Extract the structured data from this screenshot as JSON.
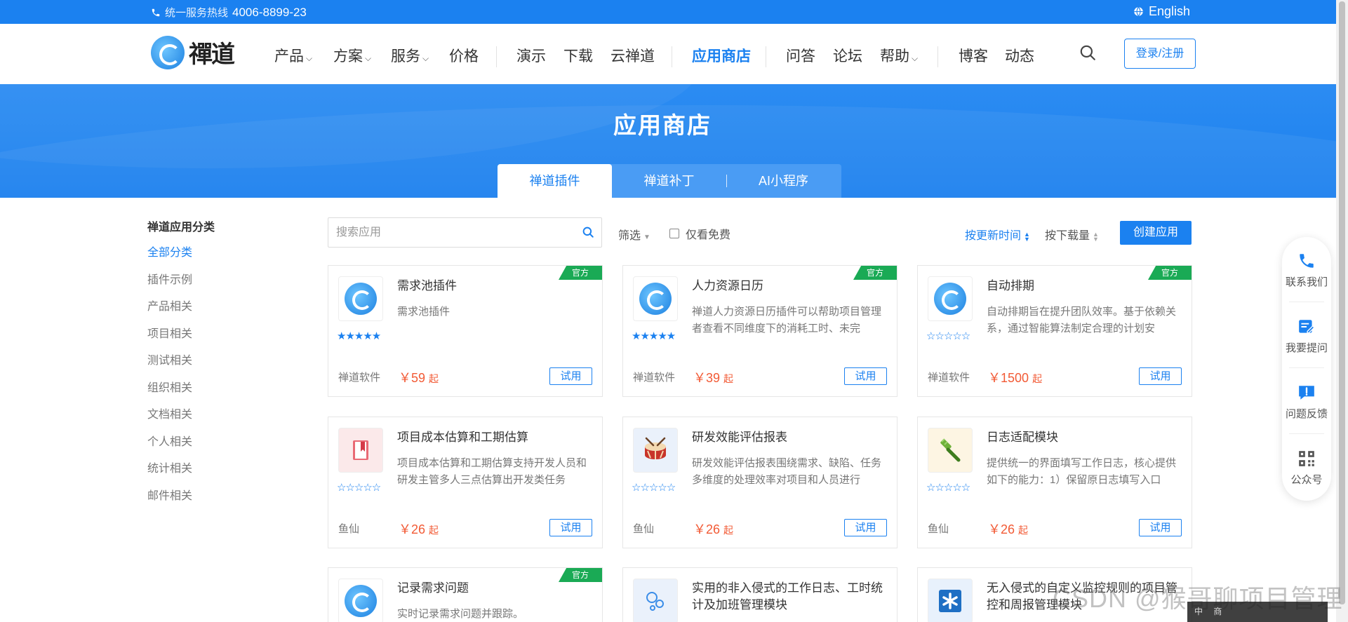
{
  "topbar": {
    "hotline_label": "统一服务热线",
    "hotline_number": "4006-8899-23",
    "language": "English"
  },
  "logo": {
    "text": "禪道"
  },
  "nav": {
    "items": [
      {
        "label": "产品",
        "has_menu": true
      },
      {
        "label": "方案",
        "has_menu": true
      },
      {
        "label": "服务",
        "has_menu": true
      },
      {
        "label": "价格"
      },
      {
        "label": "演示"
      },
      {
        "label": "下载"
      },
      {
        "label": "云禅道"
      },
      {
        "label": "应用商店",
        "active": true
      },
      {
        "label": "问答"
      },
      {
        "label": "论坛"
      },
      {
        "label": "帮助",
        "has_menu": true
      },
      {
        "label": "博客"
      },
      {
        "label": "动态"
      }
    ],
    "login_label": "登录/注册"
  },
  "banner": {
    "title": "应用商店",
    "tabs": [
      {
        "label": "禅道插件",
        "active": true
      },
      {
        "label": "禅道补丁"
      },
      {
        "label": "AI小程序"
      }
    ]
  },
  "sidebar": {
    "title": "禅道应用分类",
    "items": [
      "全部分类",
      "插件示例",
      "产品相关",
      "项目相关",
      "测试相关",
      "组织相关",
      "文档相关",
      "个人相关",
      "统计相关",
      "邮件相关"
    ],
    "active_index": 0
  },
  "toolbar": {
    "search_placeholder": "搜索应用",
    "filter_label": "筛选",
    "free_only_label": "仅看免费",
    "sort_update": "按更新时间",
    "sort_downloads": "按下载量",
    "create_label": "创建应用"
  },
  "cards": [
    {
      "name": "需求池插件",
      "desc": "需求池插件",
      "author": "禅道软件",
      "price": "￥59",
      "price_unit": "起",
      "try": "试用",
      "official": "官方",
      "rating": 5,
      "icon": "zentao-swirl-icon"
    },
    {
      "name": "人力资源日历",
      "desc": "禅道人力资源日历插件可以帮助项目管理者查看不同维度下的消耗工时、未完",
      "author": "禅道软件",
      "price": "￥39",
      "price_unit": "起",
      "try": "试用",
      "official": "官方",
      "rating": 5,
      "icon": "zentao-swirl-icon"
    },
    {
      "name": "自动排期",
      "desc": "自动排期旨在提升团队效率。基于依赖关系，通过智能算法制定合理的计划安",
      "author": "禅道软件",
      "price": "￥1500",
      "price_unit": "起",
      "try": "试用",
      "official": "官方",
      "rating": 0,
      "icon": "zentao-swirl-icon"
    },
    {
      "name": "项目成本估算和工期估算",
      "desc": "项目成本估算和工期估算支持开发人员和研发主管多人三点估算出开发类任务",
      "author": "鱼仙",
      "price": "￥26",
      "price_unit": "起",
      "try": "试用",
      "official": "",
      "rating": 0,
      "icon": "book-icon"
    },
    {
      "name": "研发效能评估报表",
      "desc": "研发效能评估报表围绕需求、缺陷、任务多维度的处理效率对项目和人员进行",
      "author": "鱼仙",
      "price": "￥26",
      "price_unit": "起",
      "try": "试用",
      "official": "",
      "rating": 0,
      "icon": "drum-icon"
    },
    {
      "name": "日志适配模块",
      "desc": "提供统一的界面填写工作日志，核心提供如下的能力：1）保留原日志填写入口",
      "author": "鱼仙",
      "price": "￥26",
      "price_unit": "起",
      "try": "试用",
      "official": "",
      "rating": 0,
      "icon": "razor-icon"
    },
    {
      "name": "记录需求问题",
      "desc": "实时记录需求问题并跟踪。",
      "official": "官方",
      "icon": "zentao-swirl-icon"
    },
    {
      "name": "实用的非入侵式的工作日志、工时统计及加班管理模块",
      "icon": "bubbles-icon"
    },
    {
      "name": "无入侵式的自定义监控规则的项目管控和周报管理模块",
      "icon": "asterisk-icon"
    }
  ],
  "float_panel": [
    "联系我们",
    "我要提问",
    "问题反馈",
    "公众号"
  ],
  "watermark": "CSDN @猴哥聊项目管理",
  "ime": "中 商"
}
